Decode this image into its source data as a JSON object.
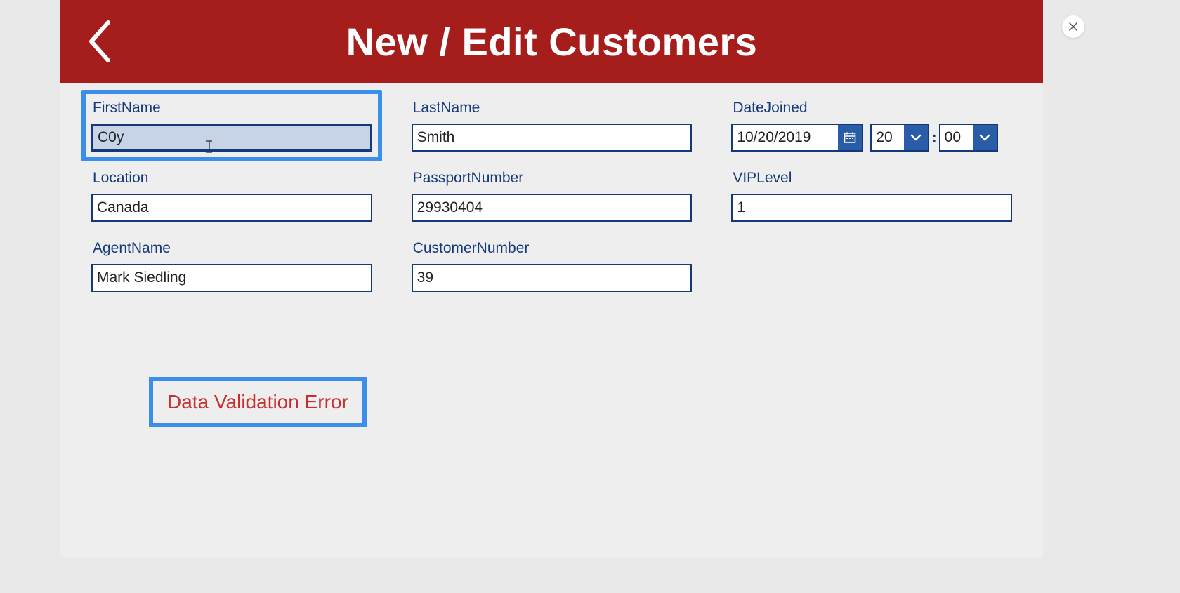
{
  "header": {
    "title": "New / Edit Customers"
  },
  "fields": {
    "firstname": {
      "label": "FirstName",
      "value": "C0y"
    },
    "lastname": {
      "label": "LastName",
      "value": "Smith"
    },
    "datejoined": {
      "label": "DateJoined",
      "date": "10/20/2019",
      "hour": "20",
      "minute": "00",
      "separator": ":"
    },
    "location": {
      "label": "Location",
      "value": "Canada"
    },
    "passport": {
      "label": "PassportNumber",
      "value": "29930404"
    },
    "viplevel": {
      "label": "VIPLevel",
      "value": "1"
    },
    "agentname": {
      "label": "AgentName",
      "value": "Mark Siedling"
    },
    "customernumber": {
      "label": "CustomerNumber",
      "value": "39"
    }
  },
  "error": {
    "message": "Data Validation Error"
  }
}
